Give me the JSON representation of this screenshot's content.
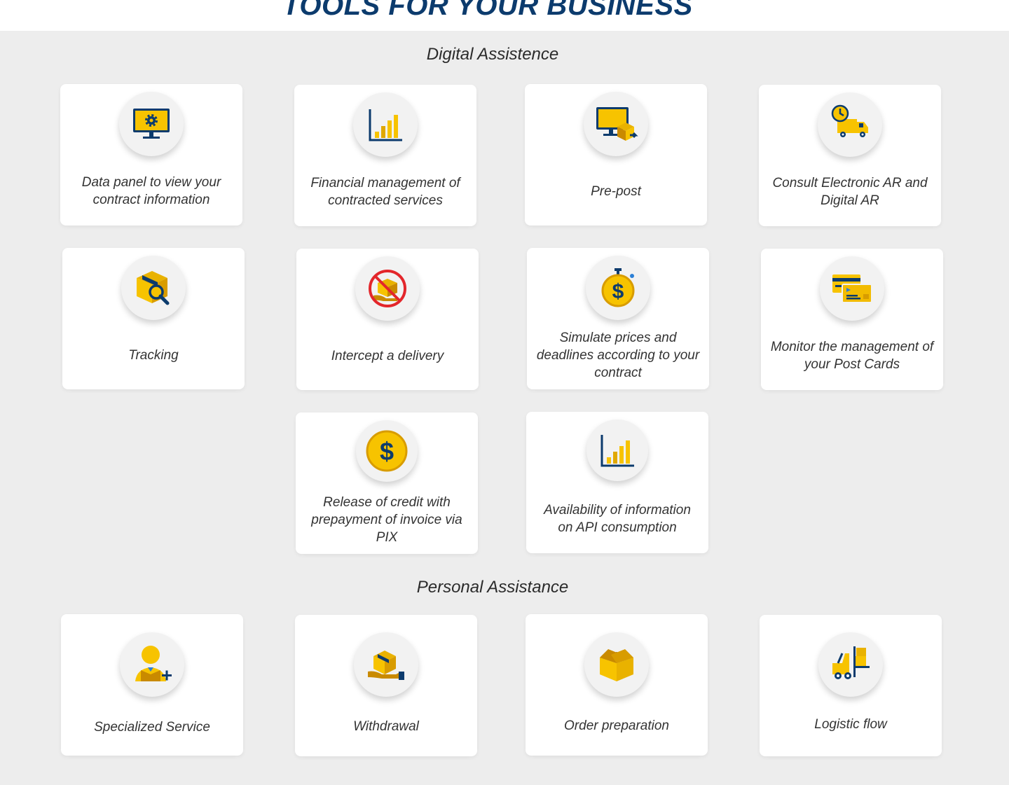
{
  "page": {
    "title": "TOOLS FOR YOUR BUSINESS"
  },
  "colors": {
    "title": "#0c3b6d",
    "accent_yellow": "#f7c300",
    "icon_blue": "#0c3b6d",
    "background": "#ededed",
    "card": "#ffffff"
  },
  "sections": [
    {
      "title": "Digital Assistence",
      "cards": [
        {
          "label": "Data panel to view your contract information",
          "icon": "monitor-gear-icon"
        },
        {
          "label": "Financial management of contracted services",
          "icon": "bar-chart-icon"
        },
        {
          "label": "Pre-post",
          "icon": "monitor-package-icon"
        },
        {
          "label": "Consult Electronic AR and Digital AR",
          "icon": "clock-truck-icon"
        },
        {
          "label": "Tracking",
          "icon": "box-search-icon"
        },
        {
          "label": "Intercept a delivery",
          "icon": "blocked-package-icon"
        },
        {
          "label": "Simulate prices and deadlines according to your contract",
          "icon": "stopwatch-dollar-icon"
        },
        {
          "label": "Monitor the management of your Post Cards",
          "icon": "credit-cards-icon"
        },
        {
          "label": "Release of credit with prepayment of invoice via PIX",
          "icon": "dollar-coin-icon"
        },
        {
          "label": "Availability of information on API consumption",
          "icon": "bar-chart-icon"
        }
      ]
    },
    {
      "title": "Personal Assistance",
      "cards": [
        {
          "label": "Specialized Service",
          "icon": "specialist-plus-icon"
        },
        {
          "label": "Withdrawal",
          "icon": "hand-package-icon"
        },
        {
          "label": "Order preparation",
          "icon": "open-box-icon"
        },
        {
          "label": "Logistic flow",
          "icon": "forklift-icon"
        }
      ]
    }
  ]
}
